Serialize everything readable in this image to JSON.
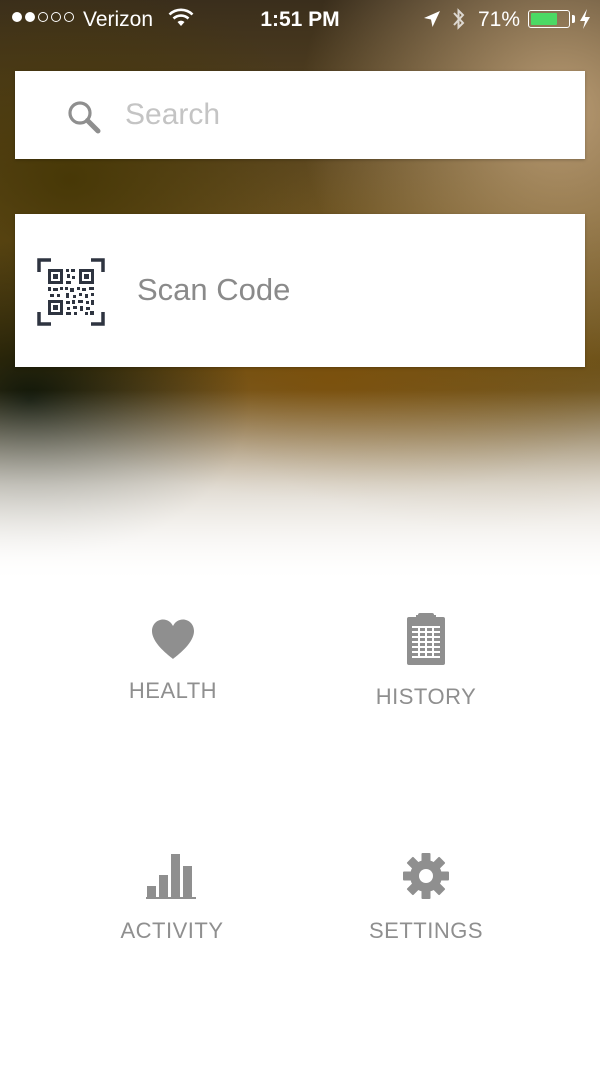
{
  "status_bar": {
    "signal_bars": 2,
    "carrier": "Verizon",
    "time": "1:51 PM",
    "battery_percent": "71%",
    "battery_level": 0.71,
    "icons": [
      "signal-dots",
      "wifi-icon",
      "location-arrow-icon",
      "bluetooth-icon",
      "battery-icon",
      "charging-bolt-icon"
    ]
  },
  "search": {
    "placeholder": "Search",
    "icon": "search-icon"
  },
  "scan": {
    "label": "Scan Code",
    "icon": "qr-code-icon"
  },
  "menu": {
    "health": {
      "label": "HEALTH",
      "icon": "heart-icon"
    },
    "history": {
      "label": "HISTORY",
      "icon": "clipboard-icon"
    },
    "activity": {
      "label": "ACTIVITY",
      "icon": "bar-chart-icon"
    },
    "settings": {
      "label": "SETTINGS",
      "icon": "gear-icon"
    }
  },
  "colors": {
    "icon_gray": "#8f8f8f",
    "battery_green": "#4cd964",
    "placeholder_gray": "#c4c4c4"
  }
}
